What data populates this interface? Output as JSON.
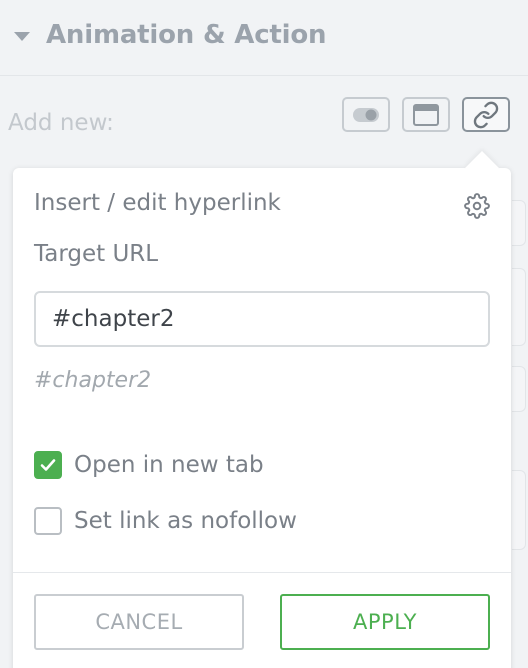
{
  "section": {
    "title": "Animation & Action"
  },
  "toolbar": {
    "add_new_label": "Add new:",
    "buttons": [
      {
        "icon": "toggle-icon"
      },
      {
        "icon": "window-icon"
      },
      {
        "icon": "link-icon"
      }
    ]
  },
  "popup": {
    "title": "Insert / edit hyperlink",
    "target_label": "Target URL",
    "url_value": "#chapter2",
    "url_preview": "#chapter2",
    "open_new_tab_label": "Open in new tab",
    "open_new_tab_checked": true,
    "nofollow_label": "Set link as nofollow",
    "nofollow_checked": false,
    "cancel_label": "CANCEL",
    "apply_label": "APPLY"
  },
  "colors": {
    "accent": "#4caf50",
    "muted_text": "#7a8088",
    "background": "#f1f3f5"
  }
}
